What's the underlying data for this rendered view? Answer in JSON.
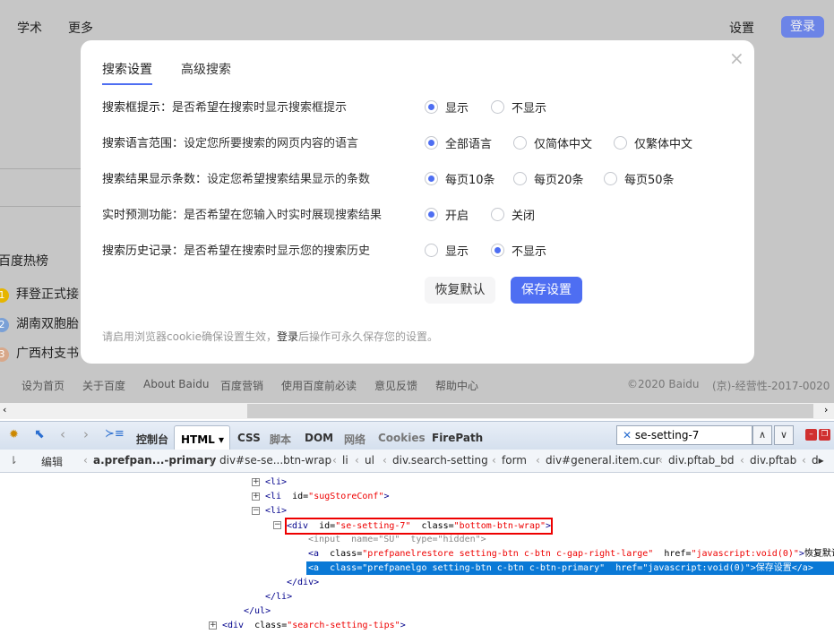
{
  "topbar": {
    "left": [
      "学术",
      "更多"
    ],
    "settings": "设置",
    "login": "登录"
  },
  "hotlist": {
    "title": "百度热榜",
    "items": [
      {
        "n": "1",
        "text": "拜登正式接",
        "color": "#e6b500"
      },
      {
        "n": "2",
        "text": "湖南双胞胎",
        "color": "#7aa0d6"
      },
      {
        "n": "3",
        "text": "广西村支书",
        "color": "#d8a88a"
      }
    ]
  },
  "footer": {
    "links": [
      "设为首页",
      "关于百度",
      "About Baidu",
      "百度营销",
      "使用百度前必读",
      "意见反馈",
      "帮助中心"
    ],
    "copyright": "©2020 Baidu",
    "icp": "(京)-经营性-2017-0020"
  },
  "dialog": {
    "tabs": [
      "搜索设置",
      "高级搜索"
    ],
    "close": "×",
    "rows": [
      {
        "label": "搜索框提示：",
        "desc": "是否希望在搜索时显示搜索框提示",
        "options": [
          "显示",
          "不显示"
        ],
        "selected": 0
      },
      {
        "label": "搜索语言范围：",
        "desc": "设定您所要搜索的网页内容的语言",
        "options": [
          "全部语言",
          "仅简体中文",
          "仅繁体中文"
        ],
        "selected": 0
      },
      {
        "label": "搜索结果显示条数：",
        "desc": "设定您希望搜索结果显示的条数",
        "options": [
          "每页10条",
          "每页20条",
          "每页50条"
        ],
        "selected": 0
      },
      {
        "label": "实时预测功能：",
        "desc": "是否希望在您输入时实时展现搜索结果",
        "options": [
          "开启",
          "关闭"
        ],
        "selected": 0
      },
      {
        "label": "搜索历史记录：",
        "desc": "是否希望在搜索时显示您的搜索历史",
        "options": [
          "显示",
          "不显示"
        ],
        "selected": 1
      }
    ],
    "restore": "恢复默认",
    "save": "保存设置",
    "tip_pre": "请启用浏览器cookie确保设置生效，",
    "tip_link": "登录",
    "tip_post": "后操作可永久保存您的设置。",
    "accent": "#4e6ef2"
  },
  "devtools": {
    "tabs": [
      "控制台",
      "HTML ▾",
      "CSS",
      "脚本",
      "DOM",
      "网络",
      "Cookies",
      "FirePath"
    ],
    "active_tab": 1,
    "search_value": "se-setting-7",
    "edit": "编辑",
    "breadcrumbs": [
      "a.prefpan...-primary",
      "div#se-se...btn-wrap",
      "li",
      "ul",
      "div.search-setting",
      "form",
      "div#general.item.cur",
      "div.pftab_bd",
      "div.pftab",
      "d▸"
    ]
  },
  "code_lines": [
    {
      "indent": 0,
      "toggle": "+",
      "parts": [
        [
          "t",
          "<li>"
        ]
      ]
    },
    {
      "indent": 0,
      "toggle": "+",
      "parts": [
        [
          "t",
          "<li  "
        ],
        [
          "a",
          "id="
        ],
        [
          "v",
          "\"sugStoreConf\""
        ],
        [
          "t",
          ">"
        ]
      ]
    },
    {
      "indent": 0,
      "toggle": "−",
      "parts": [
        [
          "t",
          "<li>"
        ]
      ]
    },
    {
      "indent": 1,
      "toggle": "−",
      "boxed": true,
      "parts": [
        [
          "t",
          "<div  "
        ],
        [
          "a",
          "id="
        ],
        [
          "v",
          "\"se-setting-7\""
        ],
        [
          "a",
          "  class="
        ],
        [
          "v",
          "\"bottom-btn-wrap\""
        ],
        [
          "t",
          ">"
        ]
      ]
    },
    {
      "indent": 2,
      "gray": true,
      "parts": [
        [
          "t",
          "<input  name=\"SU\"  type=\"hidden\">"
        ]
      ]
    },
    {
      "indent": 2,
      "parts": [
        [
          "t",
          "<a  "
        ],
        [
          "a",
          "class="
        ],
        [
          "v",
          "\"prefpanelrestore setting-btn c-btn c-gap-right-large\""
        ],
        [
          "a",
          "  href="
        ],
        [
          "v",
          "\"javascript:void(0)\""
        ],
        [
          "t",
          ">"
        ],
        [
          "a",
          "恢复默认"
        ],
        [
          "t",
          "</a>"
        ]
      ]
    },
    {
      "indent": 2,
      "selected": true,
      "parts": [
        [
          "t",
          "<a  "
        ],
        [
          "a",
          "class="
        ],
        [
          "v",
          "\"prefpanelgo setting-btn c-btn c-btn-primary\""
        ],
        [
          "a",
          "  href="
        ],
        [
          "v",
          "\"javascript:void(0)\""
        ],
        [
          "t",
          ">"
        ],
        [
          "a",
          "保存设置"
        ],
        [
          "t",
          "</a>"
        ]
      ]
    },
    {
      "indent": 1,
      "parts": [
        [
          "t",
          "</div>"
        ]
      ]
    },
    {
      "indent": 0,
      "parts": [
        [
          "t",
          "</li>"
        ]
      ]
    },
    {
      "indent": -1,
      "parts": [
        [
          "t",
          "</ul>"
        ]
      ]
    },
    {
      "indent": -2,
      "toggle": "+",
      "parts": [
        [
          "t",
          "<div  "
        ],
        [
          "a",
          "class="
        ],
        [
          "v",
          "\"search-setting-tips\""
        ],
        [
          "t",
          ">"
        ]
      ]
    }
  ]
}
